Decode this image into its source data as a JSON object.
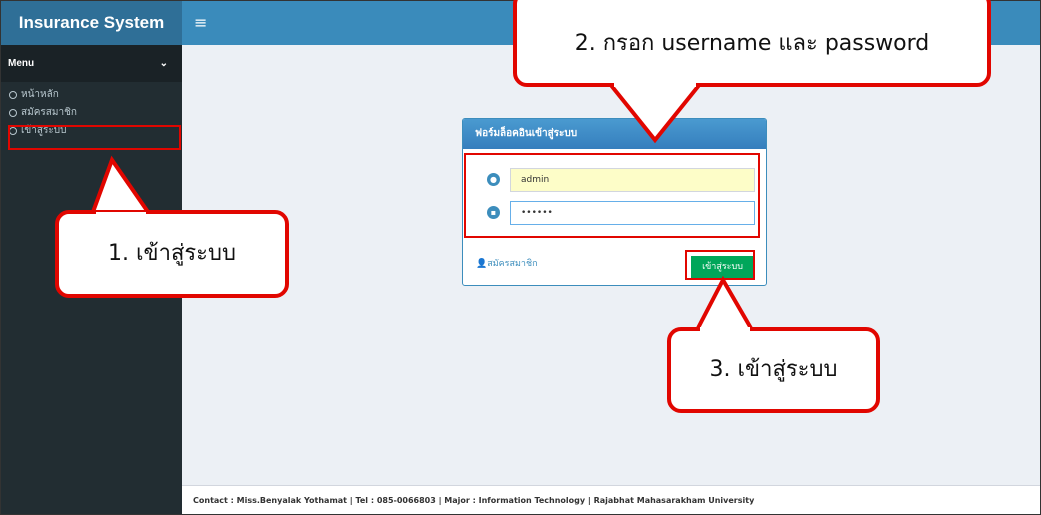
{
  "app": {
    "title": "Insurance System",
    "menu_icon": "hamburger-icon"
  },
  "sidebar": {
    "heading": "Menu",
    "items": [
      {
        "label": "หน้าหลัก",
        "icon": "circle-icon"
      },
      {
        "label": "สมัครสมาชิก",
        "icon": "circle-icon"
      },
      {
        "label": "เข้าสู่ระบบ",
        "icon": "circle-icon"
      }
    ]
  },
  "login_form": {
    "title": "ฟอร์มล็อคอินเข้าสู่ระบบ",
    "username_value": "admin",
    "username_icon": "user-icon",
    "password_value": "••••••",
    "password_icon": "lock-icon",
    "register_label": "สมัครสมาชิก",
    "login_button": "เข้าสู่ระบบ"
  },
  "footer": {
    "text": "Contact : Miss.Benyalak Yothamat | Tel : 085-0066803 | Major : Information Technology | Rajabhat Mahasarakham University"
  },
  "annotations": {
    "step1": "1. เข้าสู่ระบบ",
    "step2": "2. กรอก username และ password",
    "step3": "3. เข้าสู่ระบบ",
    "highlight_color": "#e10600"
  }
}
